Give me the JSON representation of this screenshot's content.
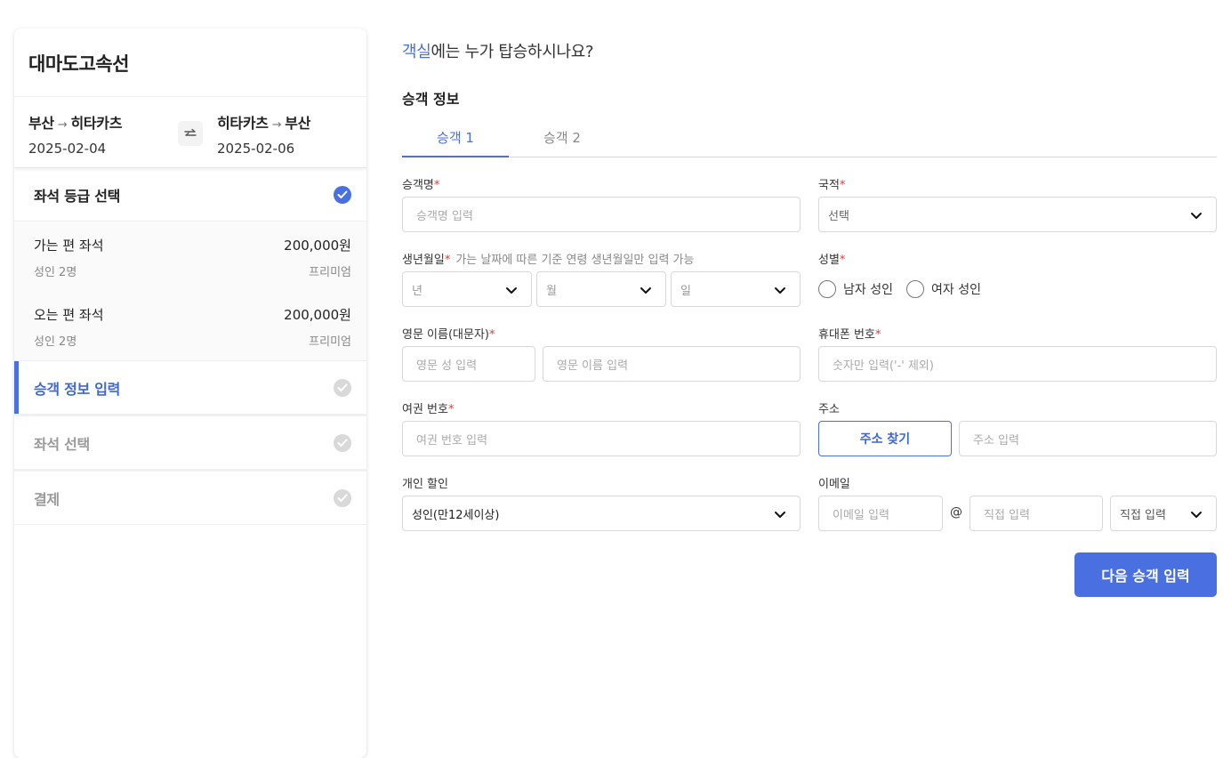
{
  "sidebar": {
    "title": "대마도고속선",
    "route_out": {
      "from": "부산",
      "to": "히타카츠",
      "date": "2025-02-04"
    },
    "route_return": {
      "from": "히타카츠",
      "to": "부산",
      "date": "2025-02-06"
    },
    "swap_icon": "swap-arrows-icon",
    "steps": {
      "seat_grade": {
        "label": "좌석 등급 선택",
        "status": "done"
      },
      "passenger_info": {
        "label": "승객 정보 입력",
        "status": "active"
      },
      "seat_select": {
        "label": "좌석 선택",
        "status": "pending"
      },
      "payment": {
        "label": "결제",
        "status": "pending"
      }
    },
    "seats": [
      {
        "label": "가는 편 좌석",
        "price": "200,000원",
        "count": "성인 2명",
        "grade": "프리미엄"
      },
      {
        "label": "오는 편 좌석",
        "price": "200,000원",
        "count": "성인 2명",
        "grade": "프리미엄"
      }
    ]
  },
  "main": {
    "question_highlight": "객실",
    "question_rest": "에는 누가 탑승하시나요?",
    "section_title": "승객 정보",
    "tabs": [
      {
        "label": "승객 1",
        "active": true
      },
      {
        "label": "승객 2",
        "active": false
      }
    ],
    "form": {
      "name": {
        "label": "승객명",
        "required": "*",
        "placeholder": "승객명 입력"
      },
      "nationality": {
        "label": "국적",
        "required": "*",
        "value": "선택"
      },
      "birth": {
        "label": "생년월일",
        "required": "*",
        "hint": "가는 날짜에 따른 기준 연령 생년월일만 입력 가능",
        "year": "년",
        "month": "월",
        "day": "일"
      },
      "gender": {
        "label": "성별",
        "required": "*",
        "options": [
          "남자 성인",
          "여자 성인"
        ]
      },
      "english_name": {
        "label": "영문 이름(대문자)",
        "required": "*",
        "last_placeholder": "영문 성 입력",
        "first_placeholder": "영문 이름 입력"
      },
      "phone": {
        "label": "휴대폰 번호",
        "required": "*",
        "placeholder": "숫자만 입력('-' 제외)"
      },
      "passport": {
        "label": "여권 번호",
        "required": "*",
        "placeholder": "여권 번호 입력"
      },
      "address": {
        "label": "주소",
        "button": "주소 찾기",
        "placeholder": "주소 입력"
      },
      "discount": {
        "label": "개인 할인",
        "value": "성인(만12세이상)"
      },
      "email": {
        "label": "이메일",
        "local_placeholder": "이메일 입력",
        "at": "@",
        "domain_placeholder": "직접 입력",
        "domain_select": "직접 입력"
      }
    },
    "next_button": "다음 승객 입력"
  },
  "colors": {
    "accent": "#4a6fe0",
    "required": "#e53935",
    "check_done": "#4a6fe0",
    "check_pending": "#d9d9d9"
  }
}
